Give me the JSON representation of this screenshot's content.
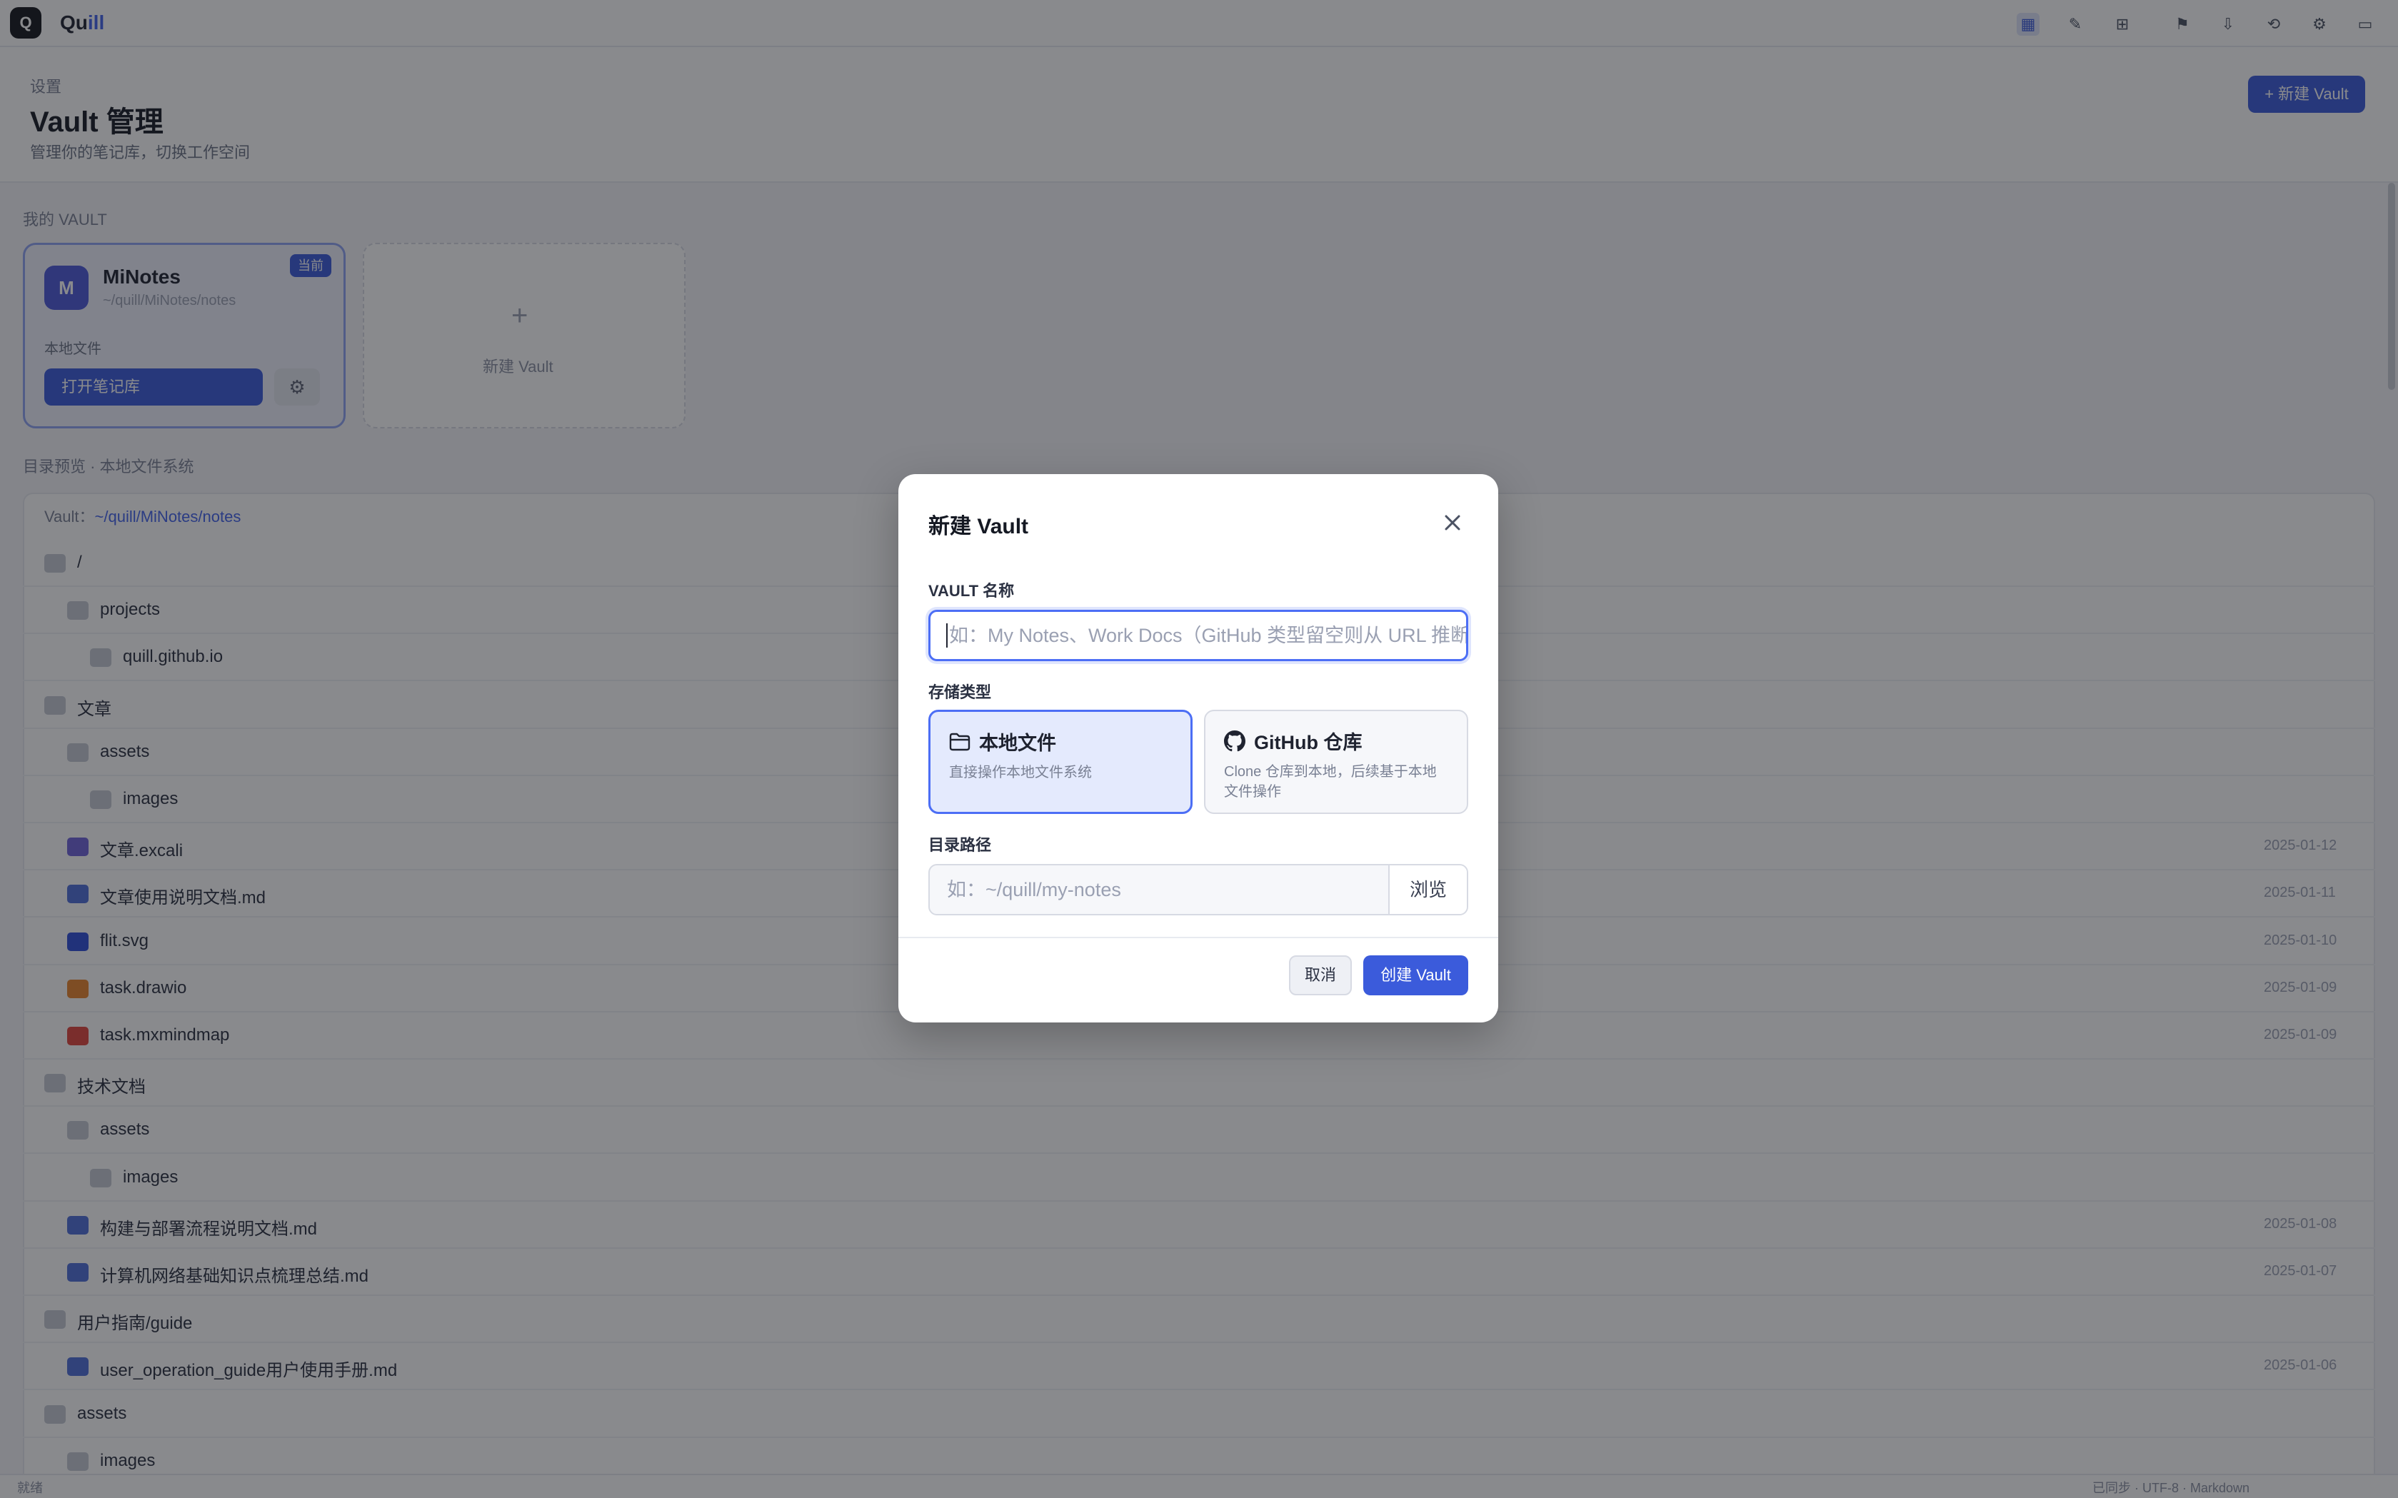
{
  "app": {
    "brand_a": "Qu",
    "brand_b": "ill"
  },
  "page": {
    "breadcrumb": "设置",
    "title": "Vault 管理",
    "subtitle": "管理你的笔记库，切换工作空间",
    "new_button": "+ 新建 Vault"
  },
  "vaults": {
    "section_label": "我的 VAULT",
    "current": {
      "name": "MiNotes",
      "path": "~/quill/MiNotes/notes",
      "badge": "当前",
      "type": "本地文件",
      "open_button": "打开笔记库"
    },
    "add_label": "新建 Vault"
  },
  "tree": {
    "header_label": "目录预览 · 本地文件系统",
    "path_label": "Vault：",
    "path_value": "~/quill/MiNotes/notes",
    "rows": [
      {
        "name": "/",
        "meta": ""
      },
      {
        "name": "projects",
        "meta": ""
      },
      {
        "name": "quill.github.io",
        "meta": ""
      },
      {
        "name": "文章",
        "meta": ""
      },
      {
        "name": "assets",
        "meta": ""
      },
      {
        "name": "images",
        "meta": ""
      },
      {
        "name": "文章.excali",
        "meta": "2025-01-12"
      },
      {
        "name": "文章使用说明文档.md",
        "meta": "2025-01-11"
      },
      {
        "name": "flit.svg",
        "meta": "2025-01-10"
      },
      {
        "name": "task.drawio",
        "meta": "2025-01-09"
      },
      {
        "name": "task.mxmindmap",
        "meta": "2025-01-09"
      },
      {
        "name": "技术文档",
        "meta": ""
      },
      {
        "name": "assets",
        "meta": ""
      },
      {
        "name": "images",
        "meta": ""
      },
      {
        "name": "构建与部署流程说明文档.md",
        "meta": "2025-01-08"
      },
      {
        "name": "计算机网络基础知识点梳理总结.md",
        "meta": "2025-01-07"
      },
      {
        "name": "用户指南/guide",
        "meta": ""
      },
      {
        "name": "user_operation_guide用户使用手册.md",
        "meta": "2025-01-06"
      },
      {
        "name": "assets",
        "meta": ""
      },
      {
        "name": "images",
        "meta": ""
      }
    ]
  },
  "status": {
    "left": "就绪",
    "right": "已同步 · UTF-8 · Markdown"
  },
  "modal": {
    "title": "新建 Vault",
    "name_label": "VAULT 名称",
    "name_placeholder": "如：My Notes、Work Docs（GitHub 类型留空则从 URL 推断）",
    "name_value": "",
    "storage_label": "存储类型",
    "storage_options": [
      {
        "title": "本地文件",
        "desc": "直接操作本地文件系统",
        "selected": true,
        "icon": "folder-icon"
      },
      {
        "title": "GitHub 仓库",
        "desc": "Clone 仓库到本地，后续基于本地文件操作",
        "selected": false,
        "icon": "github-icon"
      }
    ],
    "path_label": "目录路径",
    "path_placeholder": "如：~/quill/my-notes",
    "path_value": "",
    "browse_button": "浏览",
    "cancel_button": "取消",
    "create_button": "创建 Vault"
  },
  "colors": {
    "accent": "#3b5bdb",
    "accent_light": "#e4eafd",
    "overlay": "rgba(20,22,28,0.5)"
  }
}
